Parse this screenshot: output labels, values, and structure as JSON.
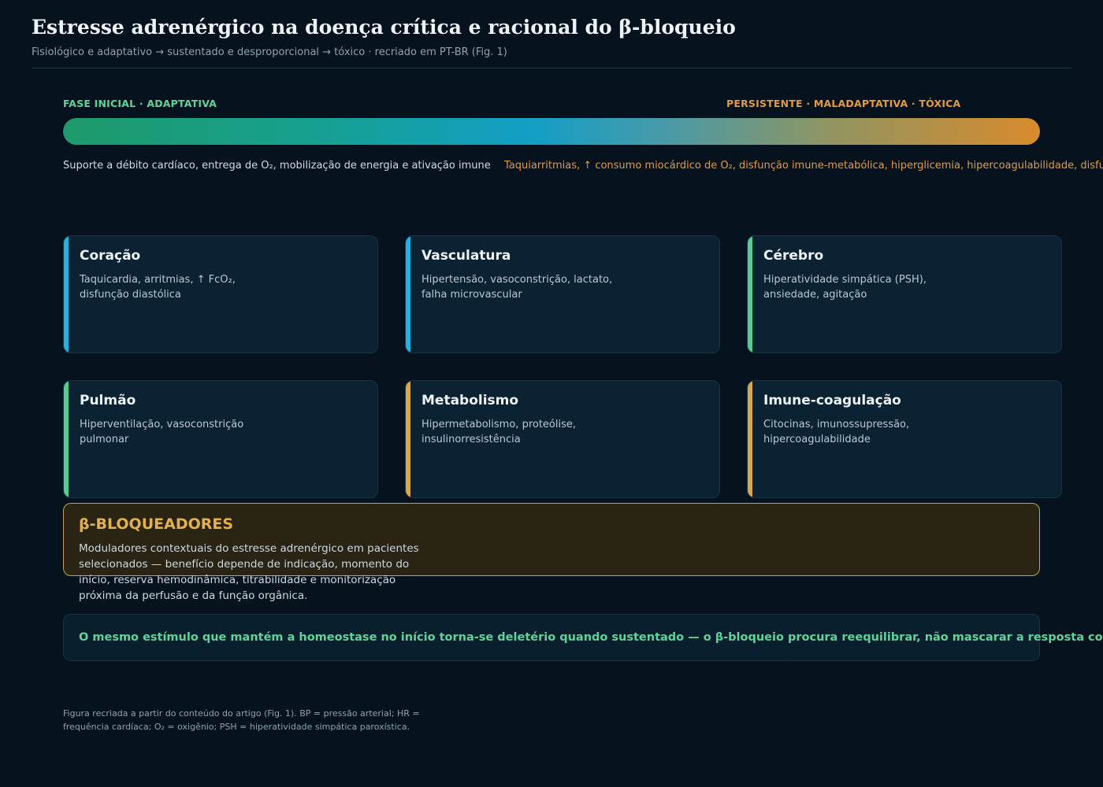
{
  "header": {
    "title": "Estresse adrenérgico na doença crítica e racional do β-bloqueio",
    "subtitle": "Fisiológico e adaptativo → sustentado e desproporcional → tóxico · recriado em PT-BR (Fig. 1)"
  },
  "spectrum": {
    "left_label": "FASE INICIAL · ADAPTATIVA",
    "right_label": "PERSISTENTE · MALADAPTATIVA · TÓXICA",
    "left_description": "Suporte a débito cardíaco, entrega de O₂, mobilização de energia e ativação imune",
    "right_description": "Taquiarritmias, ↑ consumo miocárdico de O₂, disfunção imune-metabólica, hiperglicemia, hipercoagulabilidade, disfunção"
  },
  "organs": [
    {
      "title": "Coração",
      "body": "Taquicardia, arritmias, ↑ FcO₂, disfunção diastólica",
      "accent": "#1fb5e0"
    },
    {
      "title": "Vasculatura",
      "body": "Hipertensão, vasoconstrição, lactato, falha microvascular",
      "accent": "#1fb5e0"
    },
    {
      "title": "Cérebro",
      "body": "Hiperatividade simpática (PSH), ansiedade, agitação",
      "accent": "#4fd08f"
    },
    {
      "title": "Pulmão",
      "body": "Hiperventilação, vasoconstrição pulmonar",
      "accent": "#4fd08f"
    },
    {
      "title": "Metabolismo",
      "body": "Hipermetabolismo, proteólise, insulinorresistência",
      "accent": "#d9a84a"
    },
    {
      "title": "Imune-coagulação",
      "body": "Citocinas, imunossupressão, hipercoagulabilidade",
      "accent": "#d9a84a"
    }
  ],
  "beta_blockers": {
    "title": "β-BLOQUEADORES",
    "body": "Moduladores contextuais do estresse adrenérgico em pacientes selecionados — benefício depende de indicação, momento do início, reserva hemodinâmica, titrabilidade e monitorização próxima da perfusão e da função orgânica."
  },
  "key_message": "O mesmo estímulo que mantém a homeostase no início torna-se deletério quando sustentado — o β-bloqueio procura reequilibrar, não mascarar a resposta compensatória do choque.",
  "footnote": "Figura recriada a partir do conteúdo do artigo (Fig. 1). BP = pressão arterial; HR = frequência cardíaca; O₂ = oxigênio; PSH = hiperatividade simpática paroxística.",
  "colors": {
    "background": "#06131e",
    "adaptive": "#5fd49a",
    "toxic": "#e59a3c",
    "beta": "#e2b04f"
  }
}
